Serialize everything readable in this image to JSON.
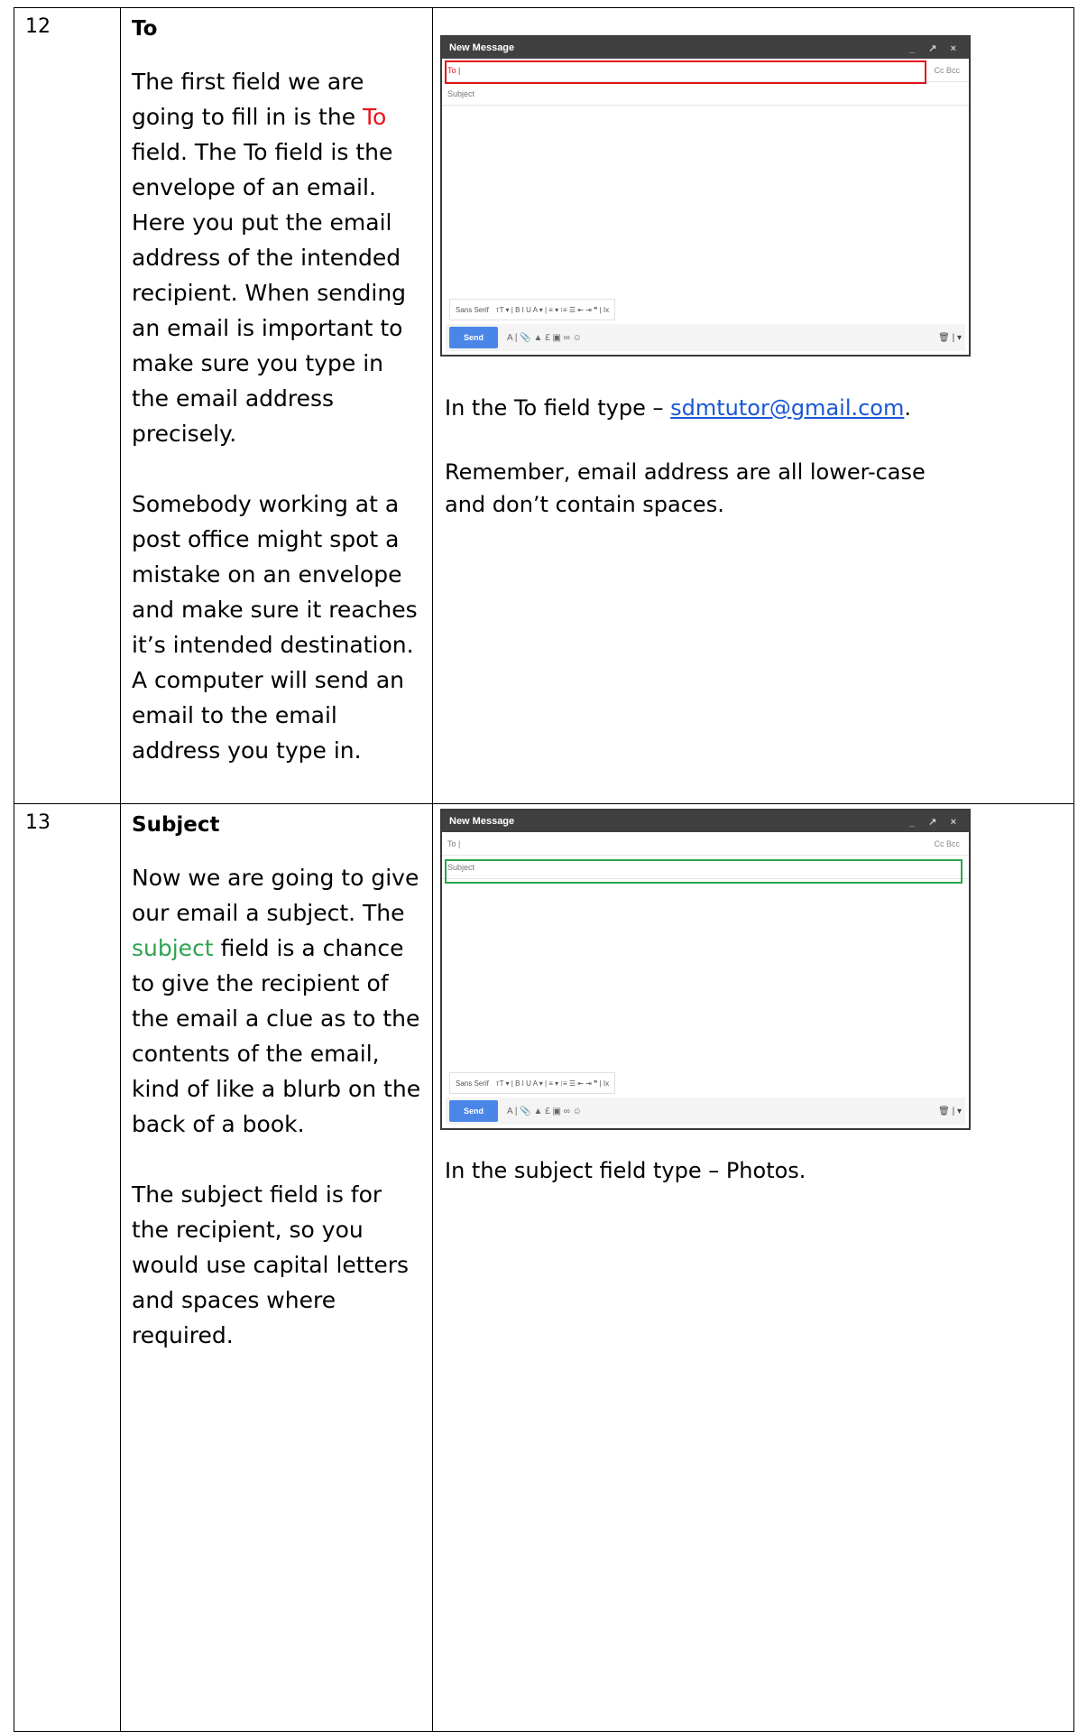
{
  "rows": [
    {
      "number": "12",
      "heading": "To",
      "para1_before": "The first field we are going to fill in is the ",
      "para1_highlight": "To",
      "para1_after": " field. The To field is the envelope of an email. Here you put the email address of the intended recipient. When sending an email is important to make sure you type in the email address precisely.",
      "para2": "Somebody working at a post office might spot a mistake on an envelope and make sure it reaches it’s intended destination. A computer will send an email to the email address you type in.",
      "instruction_before": "In the To field type – ",
      "instruction_link": "sdmtutor@gmail.com",
      "instruction_after": ".",
      "instruction2": "Remember, email address are all lower-case and don’t contain spaces.",
      "highlight_color": "#e8141a"
    },
    {
      "number": "13",
      "heading": "Subject",
      "para1_before": "Now we are going to give our email a subject. The ",
      "para1_highlight": "subject",
      "para1_after": " field is a chance to give the recipient of the email a clue as to the contents of the email, kind of like a blurb on the back of a book.",
      "para2": "The subject field is for the recipient, so you would use capital letters and spaces where required.",
      "instruction": "In the subject field type – Photos.",
      "highlight_color": "#2ea44f"
    }
  ],
  "compose": {
    "title": "New Message",
    "window_controls": "_ ↗ ×",
    "to_label": "To |",
    "cc_bcc": "Cc Bcc",
    "subject_placeholder": "Subject",
    "font_name": "Sans Serif",
    "format_icons": "ᴛT ▾ | B I U A ▾ | ≡ ▾ ⁝≡ ☰ ⇤ ⇥ ❞ | Ix",
    "send_label": "Send",
    "action_icons": "A | 📎 ▲ £ ▣ ∞ ☺",
    "trash": "🗑 | ▾"
  }
}
